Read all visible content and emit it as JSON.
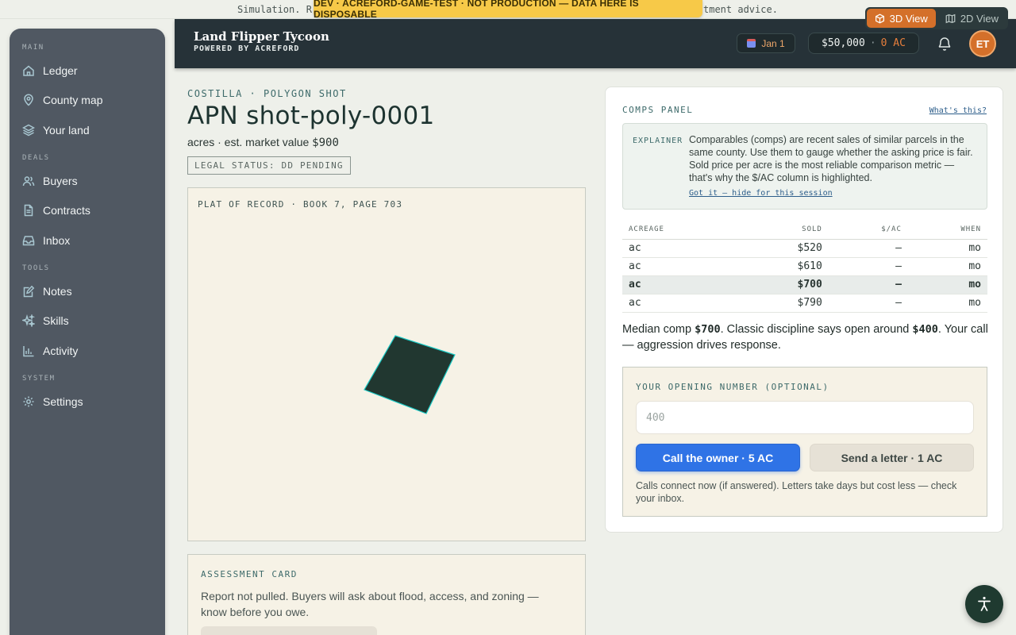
{
  "disclaimer": {
    "left_text": "Simulation. R",
    "right_text": "tment advice."
  },
  "dev_banner": "DEV · ACREFORD-GAME-TEST · NOT PRODUCTION — DATA HERE IS DISPOSABLE",
  "view_toggle": {
    "view_3d": "3D View",
    "view_2d": "2D View",
    "active": "3D View"
  },
  "sidebar": {
    "sections": [
      {
        "label": "MAIN",
        "items": [
          {
            "label": "Ledger",
            "icon": "home-icon"
          },
          {
            "label": "County map",
            "icon": "map-pin-icon"
          },
          {
            "label": "Your land",
            "icon": "layers-icon"
          }
        ]
      },
      {
        "label": "DEALS",
        "items": [
          {
            "label": "Buyers",
            "icon": "users-icon"
          },
          {
            "label": "Contracts",
            "icon": "document-icon"
          },
          {
            "label": "Inbox",
            "icon": "inbox-icon"
          }
        ]
      },
      {
        "label": "TOOLS",
        "items": [
          {
            "label": "Notes",
            "icon": "notes-icon"
          },
          {
            "label": "Skills",
            "icon": "sparkles-icon"
          },
          {
            "label": "Activity",
            "icon": "chart-icon"
          }
        ]
      },
      {
        "label": "SYSTEM",
        "items": [
          {
            "label": "Settings",
            "icon": "gear-icon"
          }
        ]
      }
    ]
  },
  "header": {
    "title": "Land Flipper Tycoon",
    "subtitle": "POWERED BY ACREFORD",
    "date": "Jan 1",
    "cash": "$50,000",
    "separator": "·",
    "ac_balance": "0 AC",
    "avatar_initials": "ET"
  },
  "parcel": {
    "kicker": "COSTILLA · POLYGON SHOT",
    "title": "APN shot-poly-0001",
    "subline_prefix": "acres · est. market value",
    "market_value": "$900",
    "legal_status": "LEGAL STATUS: DD PENDING",
    "plat_label": "PLAT OF RECORD · BOOK 7, PAGE 703"
  },
  "assessment": {
    "label": "ASSESSMENT CARD",
    "text": "Report not pulled. Buyers will ask about flood, access, and zoning — know before you owe."
  },
  "comps": {
    "title": "COMPS PANEL",
    "whats_this": "What's this?",
    "explainer_tag": "EXPLAINER",
    "explainer_text": "Comparables (comps) are recent sales of similar parcels in the same county. Use them to gauge whether the asking price is fair. Sold price per acre is the most reliable comparison metric — that's why the $/AC column is highlighted.",
    "explainer_link": "Got it — hide for this session",
    "columns": [
      "ACREAGE",
      "SOLD",
      "$/AC",
      "WHEN"
    ],
    "rows": [
      [
        "ac",
        "$520",
        "—",
        "mo"
      ],
      [
        "ac",
        "$610",
        "—",
        "mo"
      ],
      [
        "ac",
        "$700",
        "—",
        "mo"
      ],
      [
        "ac",
        "$790",
        "—",
        "mo"
      ]
    ],
    "highlighted_row": 2,
    "median_pre": "Median comp",
    "median_value": "$700",
    "median_mid": ". Classic discipline says open around",
    "open_value": "$400",
    "median_post": ". Your call — aggression drives response."
  },
  "opening": {
    "label": "YOUR OPENING NUMBER (OPTIONAL)",
    "placeholder": "400",
    "value": "",
    "call_button": "Call the owner · 5 AC",
    "letter_button": "Send a letter · 1 AC",
    "note": "Calls connect now (if answered). Letters take days but cost less — check your inbox."
  },
  "accessibility_button": "accessibility-icon"
}
